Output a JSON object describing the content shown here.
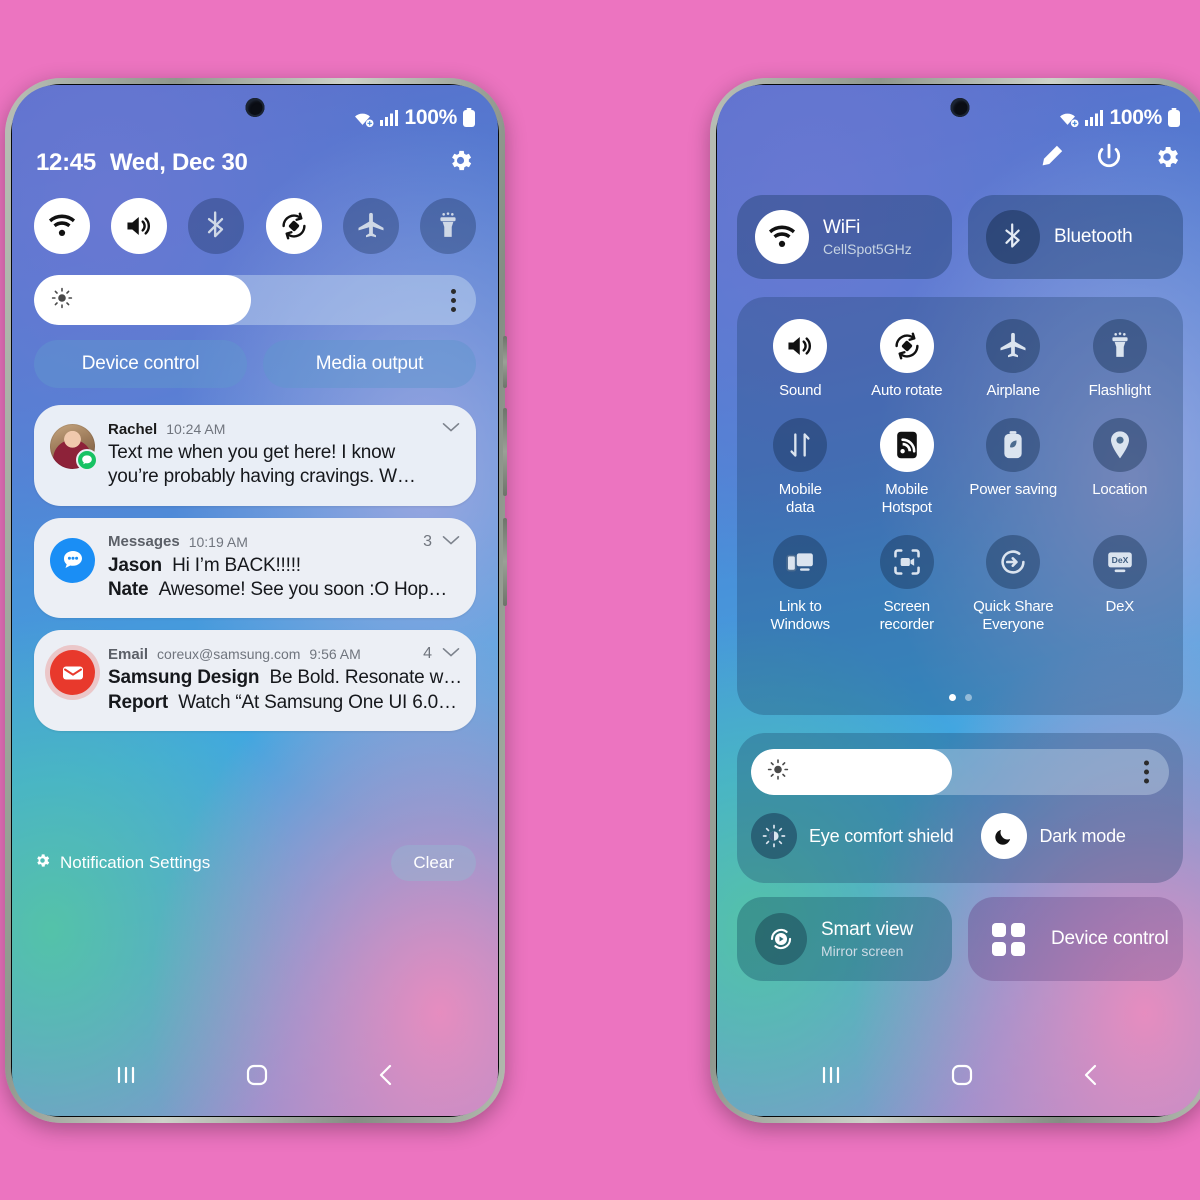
{
  "background_color": "#ec74c0",
  "status_bar": {
    "battery_percent": "100%",
    "wifi_icon": "wifi-icon",
    "signal_icon": "cellular-signal-icon",
    "battery_icon": "battery-full-icon"
  },
  "left_phone": {
    "header": {
      "clock": "12:45",
      "date": "Wed, Dec 30",
      "settings_icon": "gear-icon"
    },
    "quick_toggles": [
      {
        "name": "wifi",
        "icon": "wifi-icon",
        "active": true
      },
      {
        "name": "sound",
        "icon": "sound-icon",
        "active": true
      },
      {
        "name": "bluetooth",
        "icon": "bluetooth-icon",
        "active": false
      },
      {
        "name": "auto-rotate",
        "icon": "auto-rotate-icon",
        "active": true
      },
      {
        "name": "airplane",
        "icon": "airplane-icon",
        "active": false
      },
      {
        "name": "flashlight",
        "icon": "flashlight-icon",
        "active": false
      }
    ],
    "brightness": {
      "value_percent": 49,
      "icon": "brightness-sun-icon",
      "menu_icon": "more-options-icon"
    },
    "pills": [
      {
        "label": "Device control"
      },
      {
        "label": "Media output"
      }
    ],
    "notifications": [
      {
        "type": "message",
        "app": "Rachel",
        "time": "10:24 AM",
        "count": "",
        "icon": "avatar",
        "badge_icon": "messages-badge-icon",
        "expand_icon": "chevron-down-icon",
        "line1": "Text me when you get here! I know",
        "line2": "you’re probably having cravings. W…"
      },
      {
        "type": "messages",
        "app": "Messages",
        "time": "10:19 AM",
        "count": "3",
        "icon": "messages-icon",
        "expand_icon": "chevron-down-icon",
        "sender1": "Jason",
        "text1": "Hi I’m BACK!!!!!",
        "sender2": "Nate",
        "text2": "Awesome! See you soon :O Hop…"
      },
      {
        "type": "email",
        "app": "Email",
        "account": "coreux@samsung.com",
        "time": "9:56 AM",
        "count": "4",
        "icon": "email-icon",
        "expand_icon": "chevron-down-icon",
        "sender1": "Samsung Design",
        "text1": "Be Bold. Resonate w…",
        "sender2": "Report",
        "text2": "Watch “At Samsung One UI 6.0…"
      }
    ],
    "footer": {
      "settings_label": "Notification Settings",
      "settings_icon": "gear-icon",
      "clear_label": "Clear"
    }
  },
  "right_phone": {
    "header_icons": [
      {
        "name": "edit-pencil-icon"
      },
      {
        "name": "power-icon"
      },
      {
        "name": "gear-icon"
      }
    ],
    "big_cards": [
      {
        "name": "wifi",
        "title": "WiFi",
        "subtitle": "CellSpot5GHz",
        "icon": "wifi-icon",
        "active": true
      },
      {
        "name": "bluetooth",
        "title": "Bluetooth",
        "subtitle": "",
        "icon": "bluetooth-icon",
        "active": false
      }
    ],
    "tiles": [
      {
        "label": "Sound",
        "icon": "sound-icon",
        "active": true
      },
      {
        "label": "Auto rotate",
        "icon": "auto-rotate-icon",
        "active": true
      },
      {
        "label": "Airplane",
        "icon": "airplane-icon",
        "active": false
      },
      {
        "label": "Flashlight",
        "icon": "flashlight-icon",
        "active": false
      },
      {
        "label": "Mobile\ndata",
        "icon": "mobile-data-icon",
        "active": false
      },
      {
        "label": "Mobile\nHotspot",
        "icon": "hotspot-icon",
        "active": true
      },
      {
        "label": "Power saving",
        "icon": "power-saving-icon",
        "active": false
      },
      {
        "label": "Location",
        "icon": "location-pin-icon",
        "active": false
      },
      {
        "label": "Link to\nWindows",
        "icon": "link-to-windows-icon",
        "active": false
      },
      {
        "label": "Screen\nrecorder",
        "icon": "screen-recorder-icon",
        "active": false
      },
      {
        "label": "Quick Share\nEveryone",
        "icon": "quick-share-icon",
        "active": false
      },
      {
        "label": "DeX",
        "icon": "dex-icon",
        "active": false
      }
    ],
    "page_dots": {
      "total": 2,
      "active_index": 0
    },
    "brightness": {
      "value_percent": 48,
      "icon": "brightness-sun-icon",
      "menu_icon": "more-options-icon"
    },
    "modes": [
      {
        "label": "Eye comfort shield",
        "icon": "eye-comfort-icon",
        "active": false
      },
      {
        "label": "Dark mode",
        "icon": "moon-icon",
        "active": true
      }
    ],
    "bottom_cards": [
      {
        "title": "Smart view",
        "subtitle": "Mirror screen",
        "icon": "smart-view-icon"
      },
      {
        "title": "Device control",
        "subtitle": "",
        "icon": "device-control-grid-icon"
      }
    ]
  },
  "nav_bar": {
    "recents_icon": "recents-icon",
    "home_icon": "home-icon",
    "back_icon": "back-icon"
  }
}
